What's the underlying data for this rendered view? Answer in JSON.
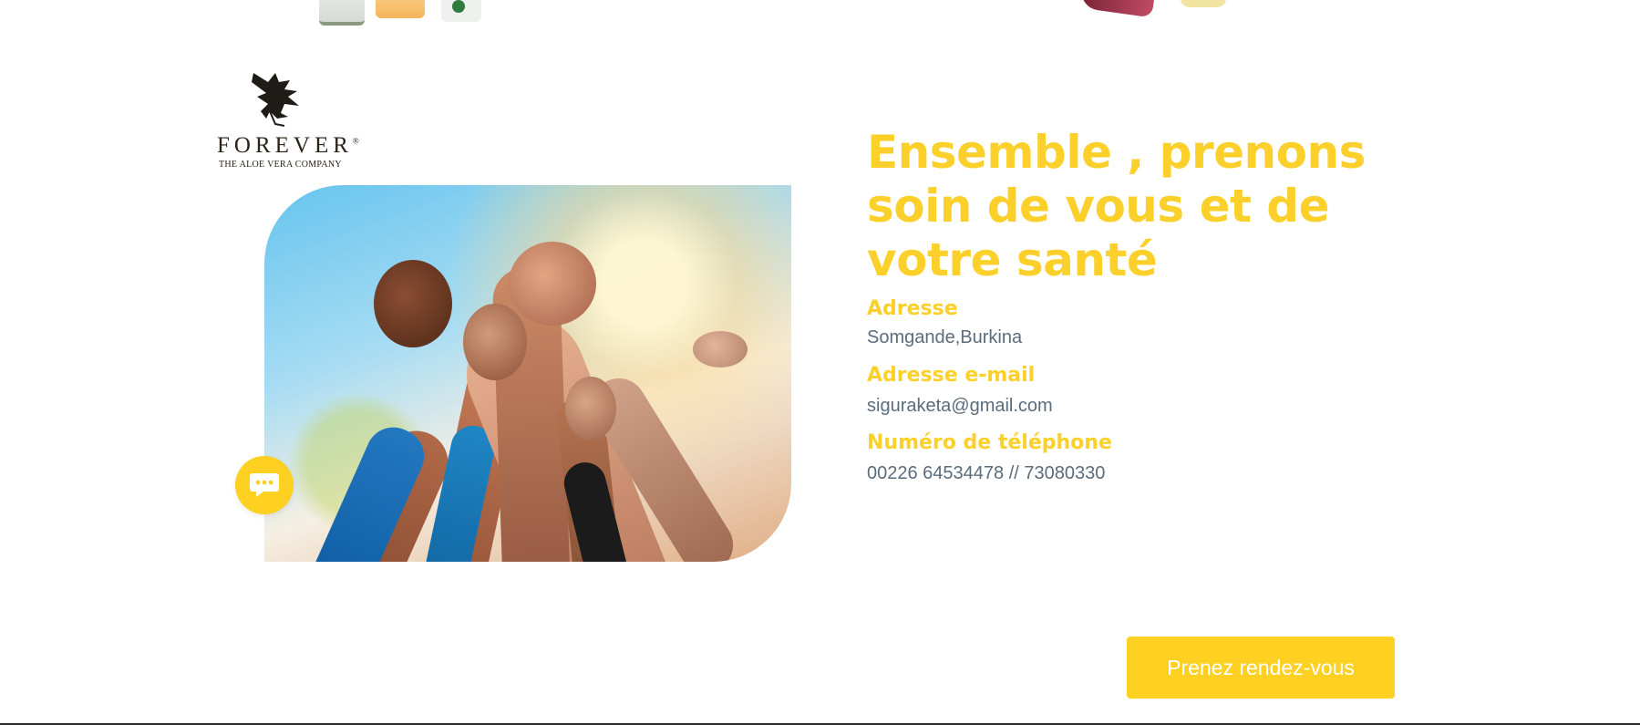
{
  "logo": {
    "wordmark": "FOREVER",
    "registered": "®",
    "tagline": "THE ALOE VERA COMPANY"
  },
  "contact": {
    "headline": "Ensemble , prenons soin de vous et de votre santé",
    "address_label": "Adresse",
    "address_value": "Somgande,Burkina",
    "email_label": "Adresse e-mail",
    "email_value": "siguraketa@gmail.com",
    "phone_label": "Numéro de téléphone",
    "phone_value": "00226 64534478 // 73080330"
  },
  "cta": {
    "label": "Prenez rendez-vous"
  },
  "chat_widget": {
    "icon": "chat-bubble-icon"
  },
  "colors": {
    "accent": "#fcd02b",
    "text_muted": "#5b6c7c",
    "button_text": "#ffffff"
  }
}
